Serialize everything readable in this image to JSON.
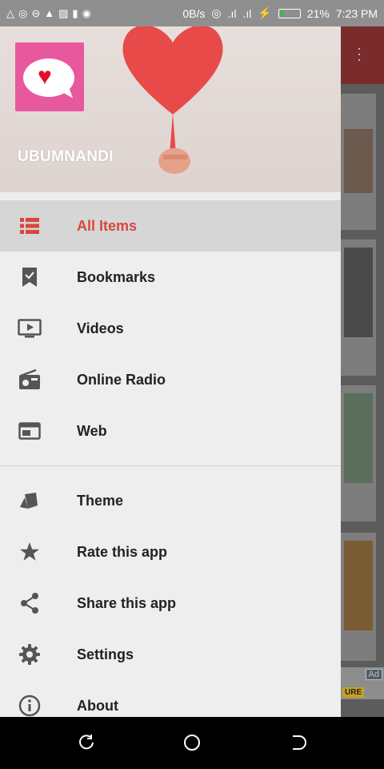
{
  "status": {
    "net_speed": "0B/s",
    "battery": "21%",
    "time": "7:23 PM"
  },
  "drawer": {
    "title": "UBUMNANDI",
    "items": [
      {
        "label": "All Items",
        "icon": "list-icon",
        "active": true
      },
      {
        "label": "Bookmarks",
        "icon": "bookmark-icon"
      },
      {
        "label": "Videos",
        "icon": "video-icon"
      },
      {
        "label": "Online Radio",
        "icon": "radio-icon"
      },
      {
        "label": "Web",
        "icon": "web-icon"
      }
    ],
    "secondary_items": [
      {
        "label": "Theme",
        "icon": "theme-icon"
      },
      {
        "label": "Rate this app",
        "icon": "star-icon"
      },
      {
        "label": "Share this app",
        "icon": "share-icon"
      },
      {
        "label": "Settings",
        "icon": "gear-icon"
      },
      {
        "label": "About",
        "icon": "info-icon"
      }
    ]
  },
  "background": {
    "ad_label": "Ad",
    "ad_snippet": "URE"
  },
  "colors": {
    "accent": "#d8473c",
    "active_bg": "#d6d6d6",
    "drawer_bg": "#eeeeee"
  }
}
